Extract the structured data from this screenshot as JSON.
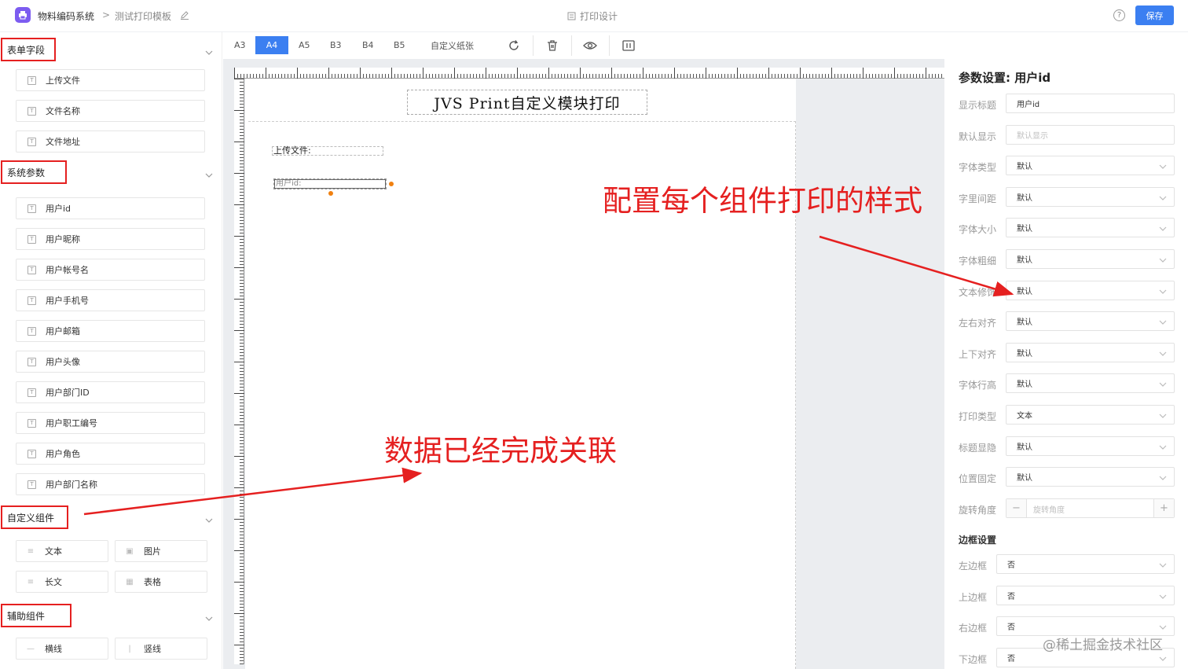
{
  "app": {
    "name": "物料编码系统",
    "separator": ">",
    "page_name": "测试打印模板",
    "center_title": "打印设计",
    "help": "?",
    "save_label": "保存"
  },
  "sidebar": {
    "sections": [
      {
        "title": "表单字段",
        "items": [
          "上传文件",
          "文件名称",
          "文件地址"
        ]
      },
      {
        "title": "系统参数",
        "items": [
          "用户id",
          "用户昵称",
          "用户帐号名",
          "用户手机号",
          "用户邮箱",
          "用户头像",
          "用户部门ID",
          "用户职工编号",
          "用户角色",
          "用户部门名称"
        ]
      },
      {
        "title": "自定义组件",
        "items": [
          "文本",
          "图片",
          "长文",
          "表格"
        ]
      },
      {
        "title": "辅助组件",
        "items": [
          "横线",
          "竖线"
        ]
      }
    ]
  },
  "toolbar": {
    "papers": [
      "A3",
      "A4",
      "A5",
      "B3",
      "B4",
      "B5",
      "自定义纸张"
    ],
    "active_paper": "A4"
  },
  "canvas": {
    "title": "JVS Print自定义模块打印",
    "field_upload": "上传文件:",
    "field_userid": "用户id:"
  },
  "panel": {
    "title": "参数设置: 用户id",
    "rows": [
      {
        "label": "显示标题",
        "value": "用户id"
      },
      {
        "label": "默认显示",
        "value": "默认显示"
      },
      {
        "label": "字体类型",
        "value": "默认"
      },
      {
        "label": "字里间距",
        "value": "默认"
      },
      {
        "label": "字体大小",
        "value": "默认"
      },
      {
        "label": "字体粗细",
        "value": "默认"
      },
      {
        "label": "文本修饰",
        "value": "默认"
      },
      {
        "label": "左右对齐",
        "value": "默认"
      },
      {
        "label": "上下对齐",
        "value": "默认"
      },
      {
        "label": "字体行高",
        "value": "默认"
      },
      {
        "label": "打印类型",
        "value": "文本"
      },
      {
        "label": "标题显隐",
        "value": "默认"
      },
      {
        "label": "位置固定",
        "value": "默认"
      }
    ],
    "rotation": {
      "label": "旋转角度",
      "placeholder": "旋转角度",
      "minus": "−",
      "plus": "+"
    },
    "border_title": "边框设置",
    "borders": [
      {
        "label": "左边框",
        "value": "否"
      },
      {
        "label": "上边框",
        "value": "否"
      },
      {
        "label": "右边框",
        "value": "否"
      },
      {
        "label": "下边框",
        "value": "否"
      }
    ]
  },
  "annotations": {
    "style_note": "配置每个组件打印的样式",
    "link_note": "数据已经完成关联",
    "accent_color": "#e52020"
  },
  "watermark": "@稀土掘金技术社区",
  "colors": {
    "primary": "#3b7ff1",
    "logo": "#7c5cf0",
    "handle": "#f08010"
  }
}
